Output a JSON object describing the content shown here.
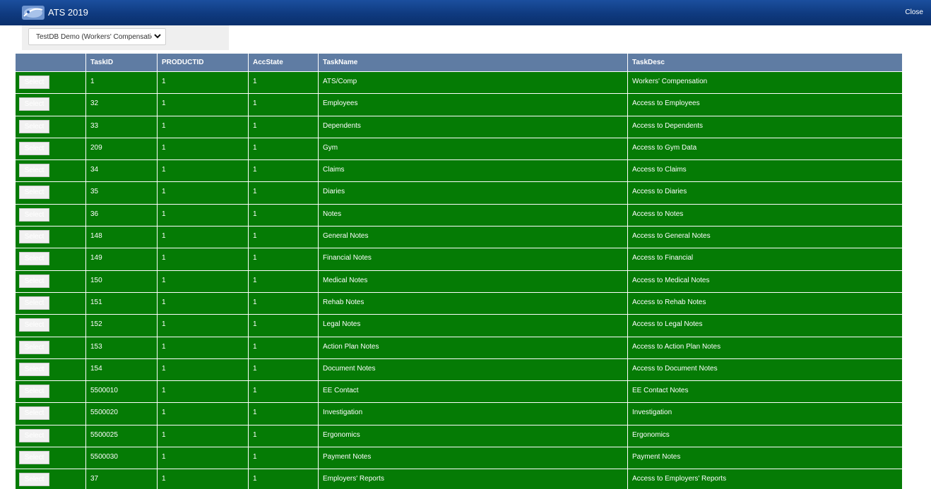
{
  "header": {
    "title": "ATS 2019",
    "close_label": "Close",
    "logo": "ats-logo-icon"
  },
  "db_selector": {
    "value": "TestDB Demo (Workers' Compensation)"
  },
  "table": {
    "columns": [
      "",
      "TaskID",
      "PRODUCTID",
      "AccState",
      "TaskName",
      "TaskDesc"
    ],
    "select_label": "Select",
    "rows": [
      {
        "taskid": "1",
        "productid": "1",
        "accstate": "1",
        "taskname": "ATS/Comp",
        "taskdesc": "Workers' Compensation"
      },
      {
        "taskid": "32",
        "productid": "1",
        "accstate": "1",
        "taskname": "Employees",
        "taskdesc": "Access to Employees"
      },
      {
        "taskid": "33",
        "productid": "1",
        "accstate": "1",
        "taskname": "Dependents",
        "taskdesc": "Access to Dependents"
      },
      {
        "taskid": "209",
        "productid": "1",
        "accstate": "1",
        "taskname": "Gym",
        "taskdesc": "Access to Gym Data"
      },
      {
        "taskid": "34",
        "productid": "1",
        "accstate": "1",
        "taskname": "Claims",
        "taskdesc": "Access to Claims"
      },
      {
        "taskid": "35",
        "productid": "1",
        "accstate": "1",
        "taskname": "Diaries",
        "taskdesc": "Access to Diaries"
      },
      {
        "taskid": "36",
        "productid": "1",
        "accstate": "1",
        "taskname": "Notes",
        "taskdesc": "Access to Notes"
      },
      {
        "taskid": "148",
        "productid": "1",
        "accstate": "1",
        "taskname": "General Notes",
        "taskdesc": "Access to General Notes"
      },
      {
        "taskid": "149",
        "productid": "1",
        "accstate": "1",
        "taskname": "Financial Notes",
        "taskdesc": "Access to Financial"
      },
      {
        "taskid": "150",
        "productid": "1",
        "accstate": "1",
        "taskname": "Medical Notes",
        "taskdesc": "Access to Medical Notes"
      },
      {
        "taskid": "151",
        "productid": "1",
        "accstate": "1",
        "taskname": "Rehab Notes",
        "taskdesc": "Access to Rehab Notes"
      },
      {
        "taskid": "152",
        "productid": "1",
        "accstate": "1",
        "taskname": "Legal Notes",
        "taskdesc": "Access to Legal Notes"
      },
      {
        "taskid": "153",
        "productid": "1",
        "accstate": "1",
        "taskname": "Action Plan Notes",
        "taskdesc": "Access to Action Plan Notes"
      },
      {
        "taskid": "154",
        "productid": "1",
        "accstate": "1",
        "taskname": "Document Notes",
        "taskdesc": "Access to Document Notes"
      },
      {
        "taskid": "5500010",
        "productid": "1",
        "accstate": "1",
        "taskname": "EE Contact",
        "taskdesc": "EE Contact Notes"
      },
      {
        "taskid": "5500020",
        "productid": "1",
        "accstate": "1",
        "taskname": "Investigation",
        "taskdesc": "Investigation"
      },
      {
        "taskid": "5500025",
        "productid": "1",
        "accstate": "1",
        "taskname": "Ergonomics",
        "taskdesc": "Ergonomics"
      },
      {
        "taskid": "5500030",
        "productid": "1",
        "accstate": "1",
        "taskname": "Payment Notes",
        "taskdesc": "Payment Notes"
      },
      {
        "taskid": "37",
        "productid": "1",
        "accstate": "1",
        "taskname": "Employers' Reports",
        "taskdesc": "Access to Employers' Reports"
      }
    ]
  },
  "colors": {
    "header_bar": "#0f3a7f",
    "table_header": "#5f7ca3",
    "row_bg": "#057b05"
  }
}
